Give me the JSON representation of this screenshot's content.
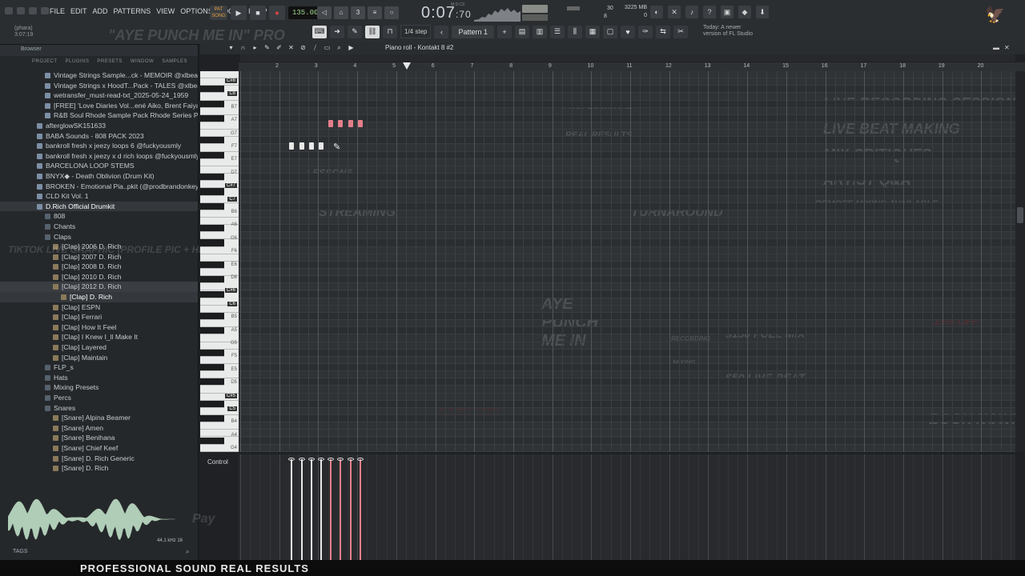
{
  "menu": [
    "FILE",
    "EDIT",
    "ADD",
    "PATTERNS",
    "VIEW",
    "OPTIONS",
    "TOOLS",
    "HELP"
  ],
  "transport": {
    "pat_song_top": "PAT",
    "pat_song_bottom": "SONG",
    "play": "▶",
    "stop": "■",
    "record": "●",
    "tempo": "135.000"
  },
  "clock": {
    "main": "0:07",
    "sub": ":70",
    "mode": "M:S:CS"
  },
  "cpu": {
    "value1": "30",
    "value2": "8"
  },
  "memory": {
    "line1": "3225 MB",
    "line2": "0"
  },
  "hint": {
    "line1": "(phara)",
    "line2": "3:07:19"
  },
  "toolbar": {
    "step": "1/4 step",
    "pattern": "Pattern 1"
  },
  "news": "Today: A newer version of FL Studio",
  "browser": {
    "title": "Browser",
    "tabs": [
      "PROJECT",
      "PLUGINS",
      "PRESETS",
      "WINDOW",
      "SAMPLES"
    ],
    "items": [
      {
        "label": "Vintage Strings Sample...ck - MEMOIR @xlbeats",
        "indent": 1,
        "kind": "pk"
      },
      {
        "label": "Vintage Strings x HoodT...Pack - TALES @xlbeats",
        "indent": 1,
        "kind": "pk"
      },
      {
        "label": "wetransfer_must-read-txt_2025-05-24_1959",
        "indent": 1,
        "kind": "pk"
      },
      {
        "label": "[FREE] 'Love Diaries Vol...ené Aiko, Brent Faiyaz, SZA",
        "indent": 1,
        "kind": "pk"
      },
      {
        "label": "R&B Soul Rhode Sample Pack Rhode Series Pt.3",
        "indent": 1,
        "kind": "pk"
      },
      {
        "label": "afterglowSK151633",
        "indent": 0,
        "kind": "pk"
      },
      {
        "label": "BABA Sounds - 808 PACK 2023",
        "indent": 0,
        "kind": "pk"
      },
      {
        "label": "bankroll fresh x jeezy loops 6 @fuckyousmly",
        "indent": 0,
        "kind": "pk"
      },
      {
        "label": "bankroll fresh x jeezy x d rich loops @fuckyousmly",
        "indent": 0,
        "kind": "pk"
      },
      {
        "label": "BARCELONA LOOP STEMS",
        "indent": 0,
        "kind": "pk"
      },
      {
        "label": "BNYX◆ - Death Oblivion (Drum Kit)",
        "indent": 0,
        "kind": "pk"
      },
      {
        "label": "BROKEN - Emotional Pia..pkit (@prodbrandonkeys)",
        "indent": 0,
        "kind": "pk"
      },
      {
        "label": "CLD Kit Vol. 1",
        "indent": 0,
        "kind": "pk"
      },
      {
        "label": "D.Rich Official Drumkit",
        "indent": 0,
        "kind": "pk",
        "hi": true
      },
      {
        "label": "808",
        "indent": 1,
        "kind": "fd"
      },
      {
        "label": "Chants",
        "indent": 1,
        "kind": "fd"
      },
      {
        "label": "Claps",
        "indent": 1,
        "kind": "fd"
      },
      {
        "label": "[Clap] 2006 D. Rich",
        "indent": 2,
        "kind": "sm"
      },
      {
        "label": "[Clap] 2007 D. Rich",
        "indent": 2,
        "kind": "sm"
      },
      {
        "label": "[Clap] 2008 D. Rich",
        "indent": 2,
        "kind": "sm"
      },
      {
        "label": "[Clap] 2010 D. Rich",
        "indent": 2,
        "kind": "sm"
      },
      {
        "label": "[Clap] 2012 D. Rich",
        "indent": 2,
        "kind": "sm",
        "sel": true
      },
      {
        "label": "[Clap] D. Rich",
        "indent": 3,
        "kind": "sm",
        "hi": true
      },
      {
        "label": "[Clap] ESPN",
        "indent": 2,
        "kind": "sm"
      },
      {
        "label": "[Clap] Ferrari",
        "indent": 2,
        "kind": "sm"
      },
      {
        "label": "[Clap] How It Feel",
        "indent": 2,
        "kind": "sm"
      },
      {
        "label": "[Clap] I Knew I_ll Make It",
        "indent": 2,
        "kind": "sm"
      },
      {
        "label": "[Clap] Layered",
        "indent": 2,
        "kind": "sm"
      },
      {
        "label": "[Clap] Maintain",
        "indent": 2,
        "kind": "sm"
      },
      {
        "label": "FLP_s",
        "indent": 1,
        "kind": "fd"
      },
      {
        "label": "Hats",
        "indent": 1,
        "kind": "fd"
      },
      {
        "label": "Mixing Presets",
        "indent": 1,
        "kind": "fd"
      },
      {
        "label": "Percs",
        "indent": 1,
        "kind": "fd"
      },
      {
        "label": "Snares",
        "indent": 1,
        "kind": "fd"
      },
      {
        "label": "[Snare] Alpina Beamer",
        "indent": 2,
        "kind": "sm"
      },
      {
        "label": "[Snare] Amen",
        "indent": 2,
        "kind": "sm"
      },
      {
        "label": "[Snare] Benihana",
        "indent": 2,
        "kind": "sm"
      },
      {
        "label": "[Snare] Chief Keef",
        "indent": 2,
        "kind": "sm"
      },
      {
        "label": "[Snare] D. Rich Generic",
        "indent": 2,
        "kind": "sm"
      },
      {
        "label": "[Snare] D. Rich",
        "indent": 2,
        "kind": "sm"
      }
    ],
    "wave_info": "44.1 kHz 16",
    "tags": "TAGS"
  },
  "piano_roll": {
    "title": "Piano roll - Kontakt 8 #2",
    "control_label": "Control",
    "ruler": [
      "2",
      "3",
      "4",
      "5",
      "6",
      "7",
      "8",
      "9",
      "10",
      "11",
      "12",
      "13",
      "14",
      "15",
      "16",
      "17",
      "18",
      "19",
      "20"
    ],
    "key_labels": [
      "C#8",
      "C8",
      "B7",
      "A7",
      "G7",
      "F7",
      "E7",
      "D7",
      "C#7",
      "C7",
      "B6",
      "A6",
      "G6",
      "F6",
      "E6",
      "D6",
      "C#6",
      "C6",
      "B5",
      "A5",
      "G5",
      "F5",
      "E5",
      "D5",
      "C#5",
      "C5",
      "B4",
      "A4",
      "G4"
    ],
    "notes": [
      {
        "beat": 0.5,
        "key": "A7",
        "color": "pink"
      },
      {
        "beat": 1.0,
        "key": "A7",
        "color": "pink"
      },
      {
        "beat": 1.5,
        "key": "A7",
        "color": "pink"
      },
      {
        "beat": 2.0,
        "key": "A7",
        "color": "pink"
      },
      {
        "beat": -1.5,
        "key": "F7",
        "color": "white"
      },
      {
        "beat": -1.0,
        "key": "F7",
        "color": "white"
      },
      {
        "beat": -0.5,
        "key": "F7",
        "color": "white"
      },
      {
        "beat": 0.0,
        "key": "F7",
        "color": "white"
      }
    ]
  },
  "watermarks": {
    "header": "\"AYE PUNCH ME IN\" PRO",
    "services": [
      "LIVE RECORDING SESSIONS",
      "LIVE BEAT MAKING",
      "MIX CRITIQUES",
      "ARTIST Q&A"
    ],
    "remote": "REMOTE MIXING AVAILABLE",
    "professional": "PROFESSIONAL",
    "results": "REAL RESULTS",
    "streaming": "STREAMING",
    "turnaround": "TURNAROUND",
    "lessons": "LESSONS",
    "recording": "RECORDING",
    "mixing": "MIXING",
    "watch": "WATCH ME",
    "book": "BOOK NOW!",
    "first": "$70 OFF FIRST TIME CLIENTS",
    "price1": "$150 FULL MIX",
    "price2": "$50 LIVE BEAT",
    "tiktok": "TIKTOK LIVE GRAPHIC (PROFILE PIC + HEA",
    "aye": "AYE PUNCH ME IN",
    "bottom": "PROFESSIONAL SOUND REAL RESULTS",
    "pay": "Pay",
    "discount": "15% OFF"
  },
  "colors": {
    "note_pink": "#e57f8b",
    "note_white": "#e8e8e8",
    "accent_red": "#b3202a"
  }
}
